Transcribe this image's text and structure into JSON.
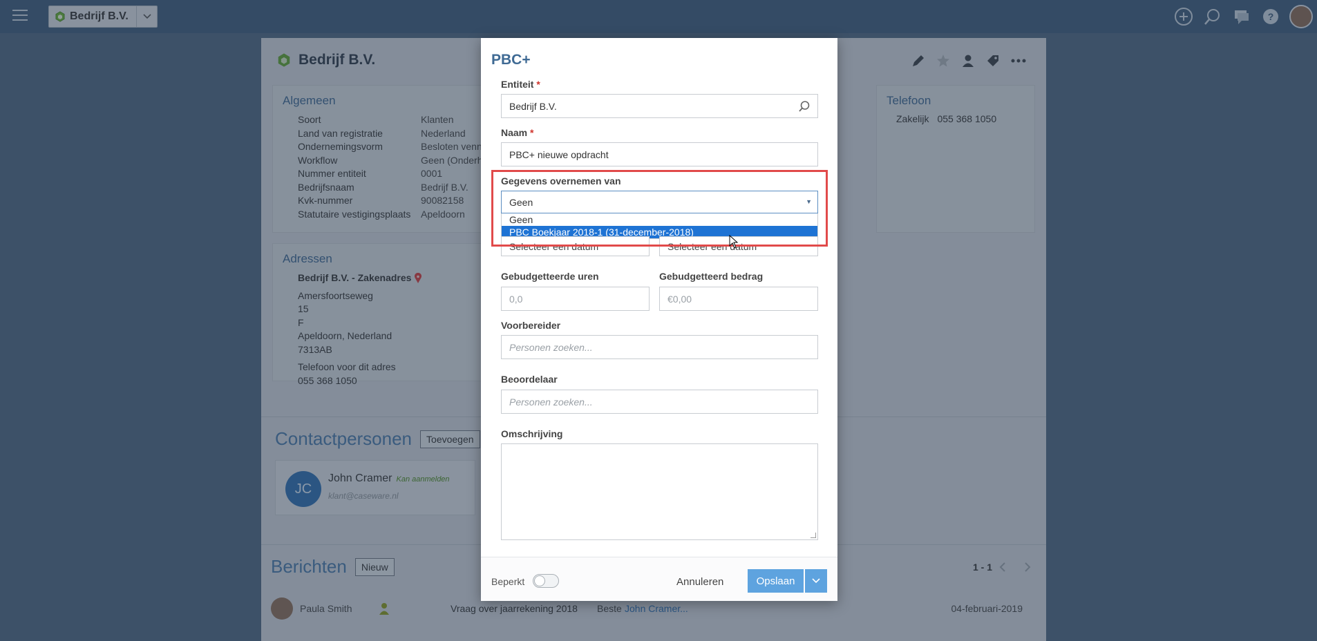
{
  "topbar": {
    "entity_name": "Bedrijf B.V."
  },
  "card": {
    "title": "Bedrijf B.V.",
    "algemeen": {
      "heading": "Algemeen",
      "rows": [
        {
          "k": "Soort",
          "v": "Klanten"
        },
        {
          "k": "Land van registratie",
          "v": "Nederland"
        },
        {
          "k": "Ondernemingsvorm",
          "v": "Besloten venn"
        },
        {
          "k": "Workflow",
          "v": "Geen (Onderh"
        },
        {
          "k": "Nummer entiteit",
          "v": "0001"
        },
        {
          "k": "Bedrijfsnaam",
          "v": "Bedrijf B.V."
        },
        {
          "k": "Kvk-nummer",
          "v": "90082158"
        },
        {
          "k": "Statutaire vestigingsplaats",
          "v": "Apeldoorn"
        }
      ]
    },
    "telefoon": {
      "heading": "Telefoon",
      "label": "Zakelijk",
      "value": "055 368 1050"
    },
    "adressen": {
      "heading": "Adressen",
      "name": "Bedrijf B.V. - Zakenadres",
      "lines": [
        "Amersfoortseweg",
        "15",
        "F",
        "Apeldoorn, Nederland",
        "7313AB"
      ],
      "phone_label": "Telefoon voor dit adres",
      "phone": "055 368 1050"
    },
    "contactpersonen": {
      "heading": "Contactpersonen",
      "add_label": "Toevoegen",
      "initials": "JC",
      "name": "John Cramer",
      "badge": "Kan aanmelden",
      "email": "klant@caseware.nl"
    },
    "berichten": {
      "heading": "Berichten",
      "new_label": "Nieuw",
      "pager": "1 - 1",
      "row": {
        "author": "Paula Smith",
        "subject": "Vraag over jaarrekening 2018",
        "preview_prefix": "Beste",
        "preview_link": "John Cramer...",
        "date": "04-februari-2019"
      }
    }
  },
  "modal": {
    "title": "PBC+",
    "entiteit": {
      "label": "Entiteit",
      "value": "Bedrijf B.V."
    },
    "naam": {
      "label": "Naam",
      "value": "PBC+ nieuwe opdracht"
    },
    "gegevens": {
      "label": "Gegevens overnemen van",
      "selected": "Geen",
      "options": [
        "Geen",
        "PBC Boekjaar 2018-1 (31-december-2018)"
      ]
    },
    "date_left_placeholder": "Selecteer een datum",
    "date_right_placeholder": "Selecteer een datum",
    "uren": {
      "label": "Gebudgetteerde uren",
      "placeholder": "0,0"
    },
    "bedrag": {
      "label": "Gebudgetteerd bedrag",
      "placeholder": "€0,00"
    },
    "voorbereider": {
      "label": "Voorbereider",
      "placeholder": "Personen zoeken..."
    },
    "beoordelaar": {
      "label": "Beoordelaar",
      "placeholder": "Personen zoeken..."
    },
    "omschrijving": {
      "label": "Omschrijving"
    },
    "footer": {
      "beperkt_label": "Beperkt",
      "cancel_label": "Annuleren",
      "save_label": "Opslaan"
    }
  },
  "colors": {
    "accent": "#5ea3df",
    "highlight": "#e14a4a",
    "selected_option": "#1e73d4"
  }
}
